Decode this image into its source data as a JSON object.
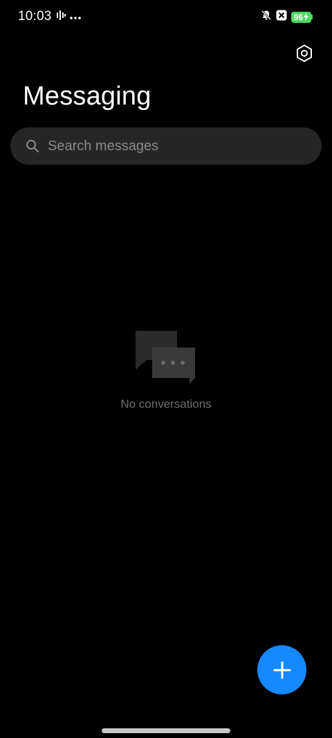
{
  "status_bar": {
    "time": "10:03",
    "battery_level": "96",
    "battery_color": "#4cd964",
    "left_icons": [
      "activity-icon",
      "more-dots-icon"
    ],
    "right_icons": [
      "mute-bell-icon",
      "close-box-icon",
      "battery-icon",
      "charging-icon"
    ]
  },
  "header": {
    "title": "Messaging",
    "settings_icon": "settings-hex-icon"
  },
  "search": {
    "placeholder": "Search messages",
    "value": ""
  },
  "empty_state": {
    "icon": "chat-bubbles-icon",
    "text": "No conversations"
  },
  "fab": {
    "icon": "plus-icon",
    "color": "#1789ff"
  }
}
